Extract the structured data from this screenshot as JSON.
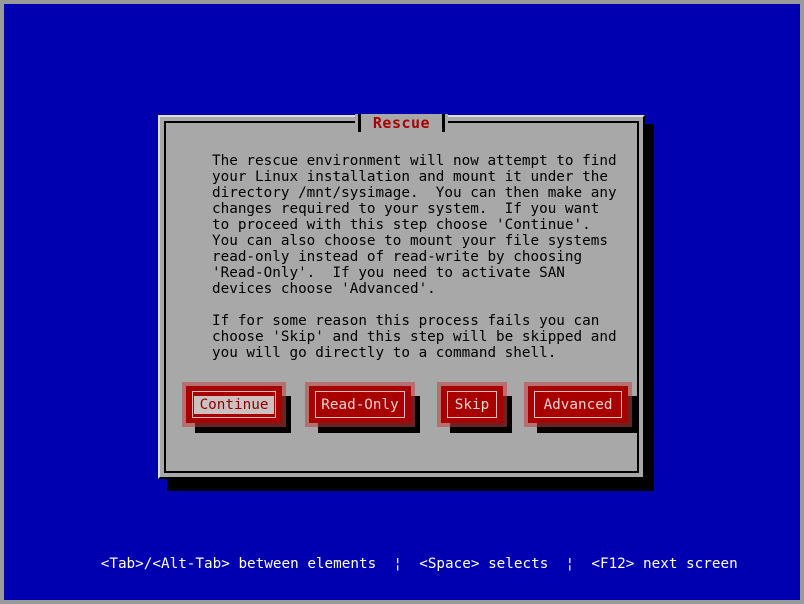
{
  "screen": {
    "background_color": "#0000b0",
    "border_color": "#9a9a9a"
  },
  "dialog": {
    "title": "Rescue",
    "title_color": "#a80000",
    "background_color": "#a8a8a8",
    "body_text": "The rescue environment will now attempt to find\nyour Linux installation and mount it under the\ndirectory /mnt/sysimage.  You can then make any\nchanges required to your system.  If you want\nto proceed with this step choose 'Continue'.\nYou can also choose to mount your file systems\nread-only instead of read-write by choosing\n'Read-Only'.  If you need to activate SAN\ndevices choose 'Advanced'.\n\nIf for some reason this process fails you can\nchoose 'Skip' and this step will be skipped and\nyou will go directly to a command shell.",
    "buttons": [
      {
        "label": "Continue",
        "focused": true,
        "color": "#a80000"
      },
      {
        "label": "Read-Only",
        "focused": false,
        "color": "#a80000"
      },
      {
        "label": "Skip",
        "focused": false,
        "color": "#a80000"
      },
      {
        "label": "Advanced",
        "focused": false,
        "color": "#a80000"
      }
    ]
  },
  "status_bar": {
    "text": "<Tab>/<Alt-Tab> between elements  ¦  <Space> selects  ¦  <F12> next screen",
    "color": "#ffffff",
    "hints": [
      {
        "keys": "<Tab>/<Alt-Tab>",
        "action": "between elements"
      },
      {
        "keys": "<Space>",
        "action": "selects"
      },
      {
        "keys": "<F12>",
        "action": "next screen"
      }
    ]
  }
}
